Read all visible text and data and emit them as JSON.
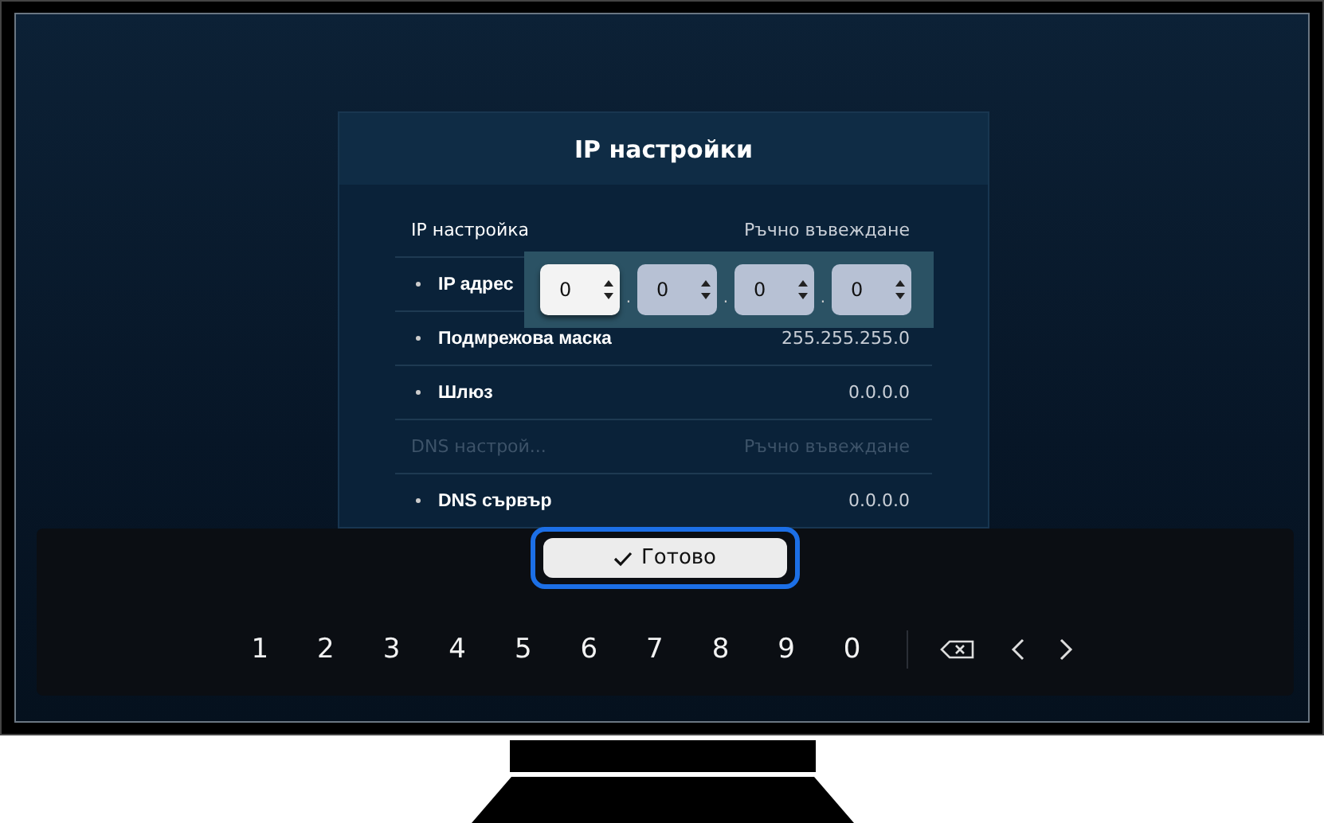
{
  "dialog": {
    "title": "IP настройки",
    "rows": [
      {
        "kind": "heading",
        "label": "IP настройка",
        "value": "Ръчно въвеждане",
        "disabled": false
      },
      {
        "kind": "sub",
        "label": "IP адрес",
        "value": "",
        "disabled": false
      },
      {
        "kind": "sub",
        "label": "Подмрежова маска",
        "value": "255.255.255.0",
        "disabled": false
      },
      {
        "kind": "sub",
        "label": "Шлюз",
        "value": "0.0.0.0",
        "disabled": false
      },
      {
        "kind": "heading",
        "label": "DNS настрой...",
        "value": "Ръчно въвеждане",
        "disabled": true
      },
      {
        "kind": "sub",
        "label": "DNS сървър",
        "value": "0.0.0.0",
        "disabled": false
      }
    ]
  },
  "ip_editor": {
    "octets": [
      {
        "value": "0",
        "selected": true
      },
      {
        "value": "0",
        "selected": false
      },
      {
        "value": "0",
        "selected": false
      },
      {
        "value": "0",
        "selected": false
      }
    ],
    "separator": "."
  },
  "keyboard": {
    "done_button": {
      "label": "Готово",
      "focused": true
    },
    "keys": [
      "1",
      "2",
      "3",
      "4",
      "5",
      "6",
      "7",
      "8",
      "9",
      "0"
    ]
  }
}
